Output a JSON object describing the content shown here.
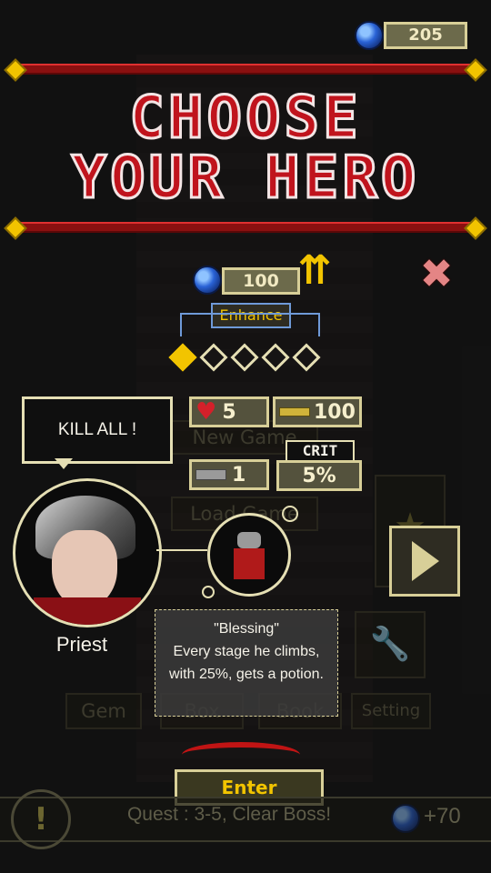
{
  "currency": {
    "gems": "205"
  },
  "title": {
    "line1": "CHOOSE",
    "line2": "YOUR HERO"
  },
  "enhance": {
    "cost": "100",
    "label": "Enhance",
    "level_filled": 1,
    "level_max": 5
  },
  "stats": {
    "hp": "5",
    "attack": "100",
    "defense": "1",
    "crit_label": "CRIT",
    "crit": "5%"
  },
  "hero": {
    "speech": "KILL ALL !",
    "name": "Priest",
    "skill_title": "\"Blessing\"",
    "skill_desc": "Every stage he climbs, with 25%, gets a potion."
  },
  "background_menu": {
    "new_game": "New Game",
    "load_game": "Load Game",
    "gem": "Gem",
    "box": "Box",
    "book": "Book",
    "setting": "Setting"
  },
  "enter_label": "Enter",
  "quest": {
    "text": "Quest : 3-5, Clear Boss!",
    "reward": "+70"
  },
  "colors": {
    "accent_red": "#c0141d",
    "gold": "#f2c400",
    "frame": "#d8cf98"
  }
}
